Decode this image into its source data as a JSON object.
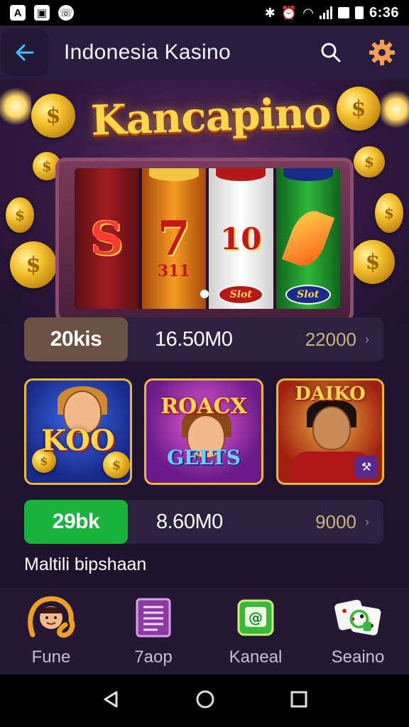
{
  "status_bar": {
    "left_icons": [
      "A",
      "image-icon",
      "whatsapp-icon"
    ],
    "time": "6:36"
  },
  "app_bar": {
    "title": "Indonesia Kasino"
  },
  "banner": {
    "brand_text": "Kancapino",
    "reel_symbols": [
      "S",
      "7",
      "10",
      "leaf"
    ],
    "reel_sublabels": [
      "311",
      "Slot",
      "Slot"
    ],
    "active_slide": 1
  },
  "stats": [
    {
      "chip": "20kis",
      "middle": "16.50M0",
      "right": "22000",
      "chip_color": "#6b5243"
    },
    {
      "chip": "29bk",
      "middle": "8.60M0",
      "right": "9000",
      "chip_color": "#17b33a"
    }
  ],
  "games": [
    {
      "title": "KOO",
      "icon": "coins-icon"
    },
    {
      "title": "ROACX",
      "subtitle": "GELTS",
      "icon": "smiling-woman-icon"
    },
    {
      "title": "DAIKO",
      "icon": "queen-icon"
    }
  ],
  "section_label": "Maltili bipshaan",
  "bottom_nav": [
    {
      "label": "Fune",
      "icon": "avatar-icon"
    },
    {
      "label": "7aop",
      "icon": "list-icon"
    },
    {
      "label": "Kaneal",
      "icon": "chat-icon"
    },
    {
      "label": "Seaino",
      "icon": "dice-icon"
    }
  ],
  "colors": {
    "background": "#231535",
    "accent_gold": "#ffd54a",
    "chip_green": "#17b33a",
    "chip_brown": "#6b5243"
  }
}
